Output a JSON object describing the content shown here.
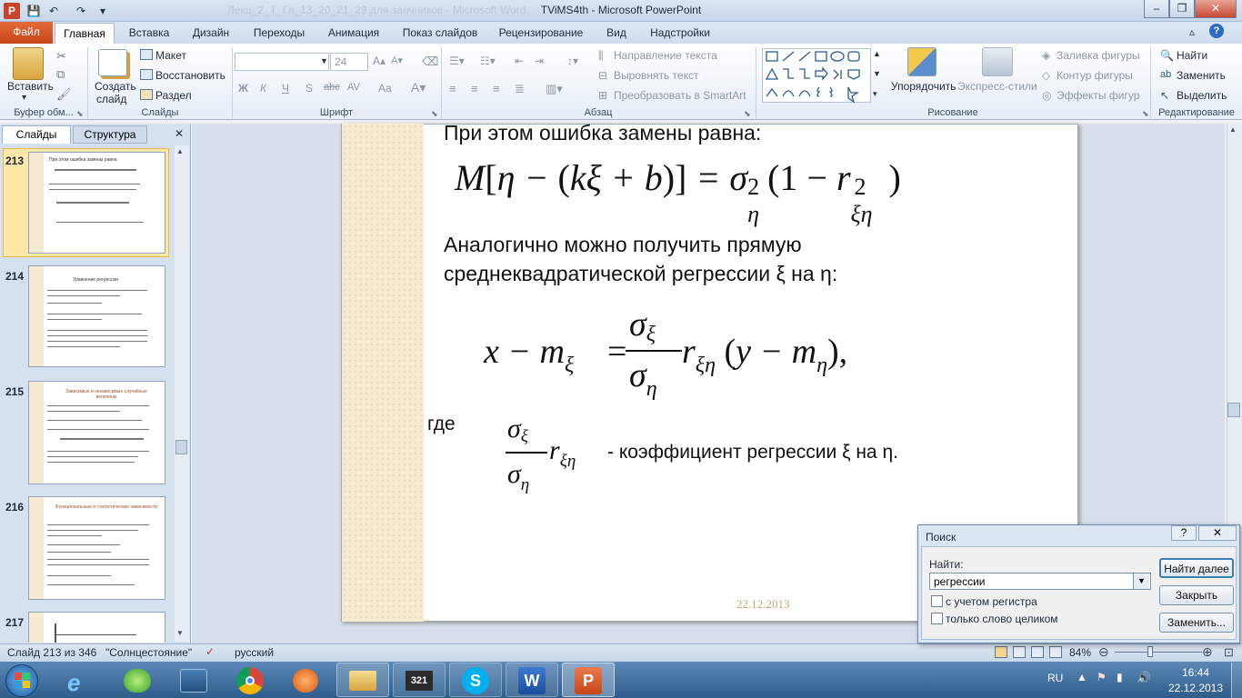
{
  "window": {
    "title": "TViMS4th  -  Microsoft PowerPoint",
    "doc_faint": "Лекц_2_Т_Гл_13_20_21_29 для заочников - Microsoft Word"
  },
  "tabs": {
    "file": "Файл",
    "items": [
      "Главная",
      "Вставка",
      "Дизайн",
      "Переходы",
      "Анимация",
      "Показ слайдов",
      "Рецензирование",
      "Вид",
      "Надстройки"
    ]
  },
  "ribbon": {
    "clipboard": {
      "paste": "Вставить",
      "label": "Буфер обм..."
    },
    "slides": {
      "new": "Создать",
      "new2": "слайд",
      "layout": "Макет",
      "reset": "Восстановить",
      "section": "Раздел",
      "label": "Слайды"
    },
    "font": {
      "size": "24",
      "bold": "Ж",
      "italic": "К",
      "underline": "Ч",
      "strike": "S",
      "abc": "abc",
      "av": "AV",
      "aa": "Aa",
      "label": "Шрифт"
    },
    "paragraph": {
      "dir": "Направление текста",
      "align": "Выровнять текст",
      "smartart": "Преобразовать в SmartArt",
      "label": "Абзац"
    },
    "drawing": {
      "arrange": "Упорядочить",
      "quick": "Экспресс-стили",
      "fill": "Заливка фигуры",
      "outline": "Контур фигуры",
      "effects": "Эффекты фигур",
      "label": "Рисование"
    },
    "editing": {
      "find": "Найти",
      "replace": "Заменить",
      "select": "Выделить",
      "label": "Редактирование"
    }
  },
  "panel": {
    "tab_slides": "Слайды",
    "tab_outline": "Структура",
    "thumbs": [
      {
        "num": "213",
        "heading": "При этом ошибка замены равна"
      },
      {
        "num": "214",
        "heading": "Уравнение регрессии"
      },
      {
        "num": "215",
        "heading": "Зависимые и независимые случайные величины"
      },
      {
        "num": "216",
        "heading": "Функциональные и статистические зависимости"
      },
      {
        "num": "217",
        "heading": ""
      }
    ]
  },
  "slide": {
    "line1": "При этом ошибка замены равна:",
    "line2a": "Аналогично можно получить прямую",
    "line2b": "среднеквадратической регрессии ξ на η:",
    "where": "где",
    "coef": "- коэффициент регрессии ξ на η.",
    "date": "22.12.2013"
  },
  "dialog": {
    "title": "Поиск",
    "find_label": "Найти:",
    "find_value": "регрессии",
    "match_case": "с учетом регистра",
    "whole_word": "только слово целиком",
    "find_next": "Найти далее",
    "close": "Закрыть",
    "replace": "Заменить..."
  },
  "status": {
    "slide": "Слайд 213 из 346",
    "theme": "\"Солнцестояние\"",
    "lang": "русский",
    "zoom": "84%"
  },
  "taskbar": {
    "lang": "RU",
    "time": "16:44",
    "date": "22.12.2013"
  }
}
